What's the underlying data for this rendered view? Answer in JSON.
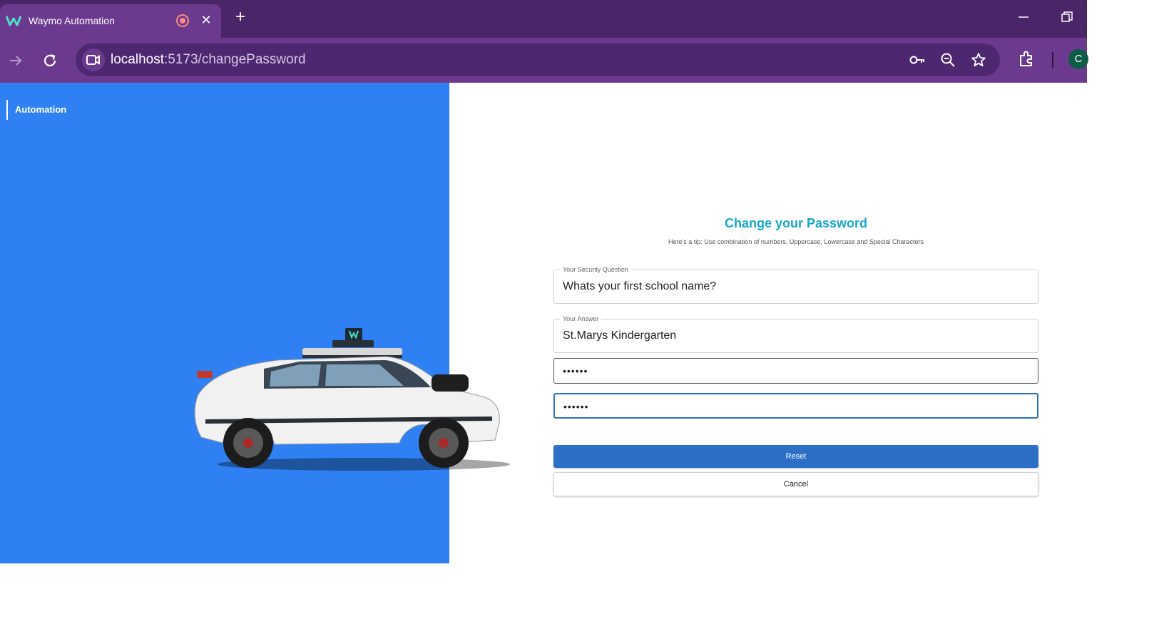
{
  "browser": {
    "tab": {
      "title": "Waymo Automation",
      "close_glyph": "✕"
    },
    "new_tab_glyph": "+",
    "address": {
      "host": "localhost",
      "path": ":5173/changePassword"
    },
    "profile_initial": "C",
    "theme_color": "#6b3a8f",
    "icons": [
      "waymo-favicon",
      "recording-icon",
      "close-icon",
      "plus-icon",
      "minimize-icon",
      "restore-icon",
      "arrow-forward-icon",
      "reload-icon",
      "video-camera-icon",
      "key-icon",
      "zoom-out-icon",
      "star-icon",
      "extensions-icon"
    ]
  },
  "sidebar": {
    "brand": "Automation",
    "background": "#2f80f2"
  },
  "form": {
    "title": "Change your Password",
    "tip": "Here's a tip: Use combination of numbers, Uppercase, Lowercase and Special Characters",
    "security_question": {
      "label": "Your Security Question",
      "value": "Whats your first school name?"
    },
    "answer": {
      "label": "Your Answer",
      "value": "St.Marys Kindergarten"
    },
    "new_password": {
      "masked": "••••••"
    },
    "confirm_password": {
      "masked": "••••••"
    },
    "reset_label": "Reset",
    "cancel_label": "Cancel",
    "accent_color": "#2c6fc7",
    "title_color": "#17a7c9"
  }
}
